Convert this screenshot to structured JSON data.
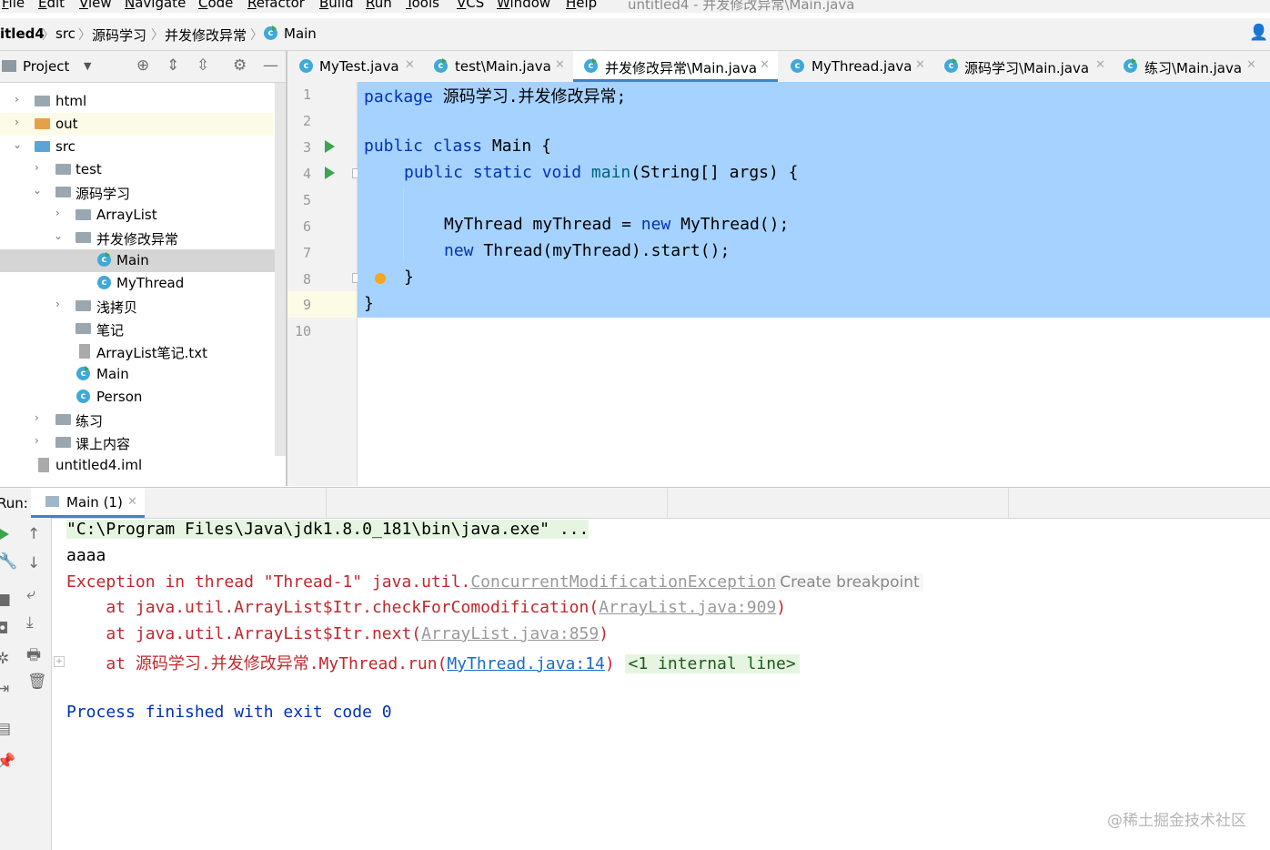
{
  "menubar": {
    "items": [
      "File",
      "Edit",
      "View",
      "Navigate",
      "Code",
      "Refactor",
      "Build",
      "Run",
      "Tools",
      "VCS",
      "Window",
      "Help"
    ],
    "window_title": "untitled4 - 并发修改异常\\Main.java"
  },
  "navbar": {
    "crumbs": [
      "itled4",
      "src",
      "源码学习",
      "并发修改异常",
      "Main"
    ]
  },
  "project_panel": {
    "title": "Project",
    "tree": [
      {
        "label": "html",
        "kind": "folder"
      },
      {
        "label": "out",
        "kind": "folder-out"
      },
      {
        "label": "src",
        "kind": "folder-src"
      },
      {
        "label": "test",
        "kind": "package"
      },
      {
        "label": "源码学习",
        "kind": "package"
      },
      {
        "label": "ArrayList",
        "kind": "package"
      },
      {
        "label": "并发修改异常",
        "kind": "package"
      },
      {
        "label": "Main",
        "kind": "class-run"
      },
      {
        "label": "MyThread",
        "kind": "class"
      },
      {
        "label": "浅拷贝",
        "kind": "package"
      },
      {
        "label": "笔记",
        "kind": "package"
      },
      {
        "label": "ArrayList笔记.txt",
        "kind": "file"
      },
      {
        "label": "Main",
        "kind": "class-run"
      },
      {
        "label": "Person",
        "kind": "class"
      },
      {
        "label": "练习",
        "kind": "package"
      },
      {
        "label": "课上内容",
        "kind": "package"
      },
      {
        "label": "untitled4.iml",
        "kind": "file"
      }
    ]
  },
  "editor": {
    "tabs": [
      {
        "label": "MyTest.java",
        "active": false
      },
      {
        "label": "test\\Main.java",
        "active": false
      },
      {
        "label": "并发修改异常\\Main.java",
        "active": true
      },
      {
        "label": "MyThread.java",
        "active": false
      },
      {
        "label": "源码学习\\Main.java",
        "active": false
      },
      {
        "label": "练习\\Main.java",
        "active": false
      }
    ],
    "line_numbers": [
      "1",
      "2",
      "3",
      "4",
      "5",
      "6",
      "7",
      "8",
      "9",
      "10"
    ],
    "code": {
      "l1_kw": "package",
      "l1_rest": " 源码学习.并发修改异常;",
      "l3_kw": "public class",
      "l3_rest": " Main {",
      "l4_kw": "public static void",
      "l4_fn": "main",
      "l4_rest": "(String[] args) {",
      "l6_a": "MyThread myThread = ",
      "l6_kw": "new",
      "l6_b": " MyThread();",
      "l7_kw": "new",
      "l7_rest": " Thread(myThread).start();",
      "l8": "}",
      "l9": "}"
    }
  },
  "run_panel": {
    "label": "Run:",
    "tab_label": "Main (1)",
    "console": {
      "cmd": "\"C:\\Program Files\\Java\\jdk1.8.0_181\\bin\\java.exe\" ...",
      "out1": "aaaa",
      "exc_prefix": "Exception in thread \"Thread-1\" java.util.",
      "exc_class": "ConcurrentModificationException",
      "exc_hint": "Create breakpoint",
      "st1_prefix": "    at java.util.ArrayList$Itr.checkForComodification(",
      "st1_link": "ArrayList.java:909",
      "st2_prefix": "    at java.util.ArrayList$Itr.next(",
      "st2_link": "ArrayList.java:859",
      "st3_prefix": "    at 源码学习.并发修改异常.MyThread.run(",
      "st3_link": "MyThread.java:14",
      "st3_internal": "<1 internal line>",
      "close_paren": ")",
      "exit": "Process finished with exit code 0"
    }
  },
  "watermark": "@稀土掘金技术社区"
}
